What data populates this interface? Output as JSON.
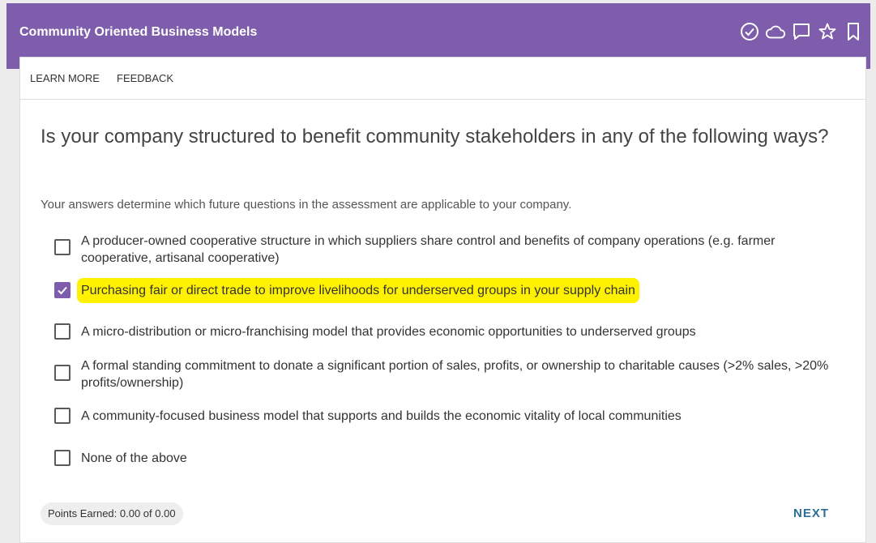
{
  "header": {
    "title": "Community Oriented Business Models",
    "icons": [
      "check-circle-icon",
      "cloud-icon",
      "comment-icon",
      "star-icon",
      "bookmark-icon"
    ],
    "background_color": "#7e5eac"
  },
  "tabs": [
    {
      "label": "LEARN MORE"
    },
    {
      "label": "FEEDBACK"
    }
  ],
  "question": {
    "text": "Is your company structured to benefit community stakeholders in any of the following ways?",
    "helper": "Your answers determine which future questions in the assessment are applicable to your company."
  },
  "options": [
    {
      "label": "A producer-owned cooperative structure in which suppliers share control and benefits of company operations (e.g. farmer cooperative, artisanal cooperative)",
      "checked": false
    },
    {
      "label": "Purchasing fair or direct trade to improve livelihoods for underserved groups in your supply chain",
      "checked": true,
      "highlight_color": "#fff200"
    },
    {
      "label": "A micro-distribution or micro-franchising model that provides economic opportunities to underserved groups",
      "checked": false
    },
    {
      "label": "A formal standing commitment to donate a significant portion of sales, profits, or ownership to charitable causes (>2% sales, >20% profits/ownership)",
      "checked": false
    },
    {
      "label": "A community-focused business model that supports and builds the economic vitality of local communities",
      "checked": false
    },
    {
      "label": "None of the above",
      "checked": false
    }
  ],
  "footer": {
    "points": "Points Earned: 0.00 of 0.00",
    "next_label": "NEXT"
  }
}
